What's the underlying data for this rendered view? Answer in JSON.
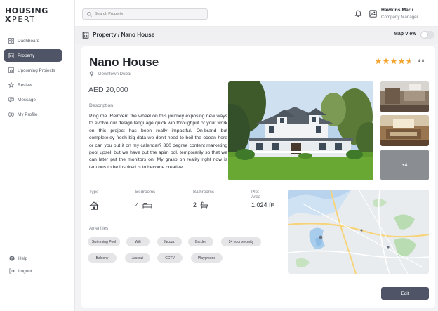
{
  "brand": {
    "line1": "HOUSING",
    "line2_mark": "X",
    "line2_rest": "PERT"
  },
  "sidebar": {
    "items": [
      {
        "label": "Dashboard",
        "icon": "grid-icon"
      },
      {
        "label": "Property",
        "icon": "building-icon",
        "active": true
      },
      {
        "label": "Upcoming Projects",
        "icon": "chart-icon"
      },
      {
        "label": "Review",
        "icon": "star-outline-icon"
      },
      {
        "label": "Message",
        "icon": "message-icon"
      },
      {
        "label": "My Profile",
        "icon": "user-circle-icon"
      }
    ],
    "bottom": [
      {
        "label": "Help",
        "icon": "help-icon"
      },
      {
        "label": "Logout",
        "icon": "logout-icon"
      }
    ]
  },
  "topbar": {
    "search_placeholder": "Search Property",
    "user_name": "Hawkins Maru",
    "user_role": "Company Manager"
  },
  "page": {
    "breadcrumb": "Property / Nano House",
    "map_view_label": "Map View",
    "map_view_on": false
  },
  "property": {
    "name": "Nano House",
    "location": "Downtown Dubai",
    "rating": "4.8",
    "price": "AED 20,000",
    "description_label": "Description",
    "description": "Ping me. Reinvent the wheel on this journey exposing new ways to evolve our design language quick win throughput or your work on this project has been really impactful. On-brand but completeley fresh big data we don't need to boil the ocean here or can you put it on my calendar? 360 degree content marketing pool upsell but we have put the apim bol, temporarily so that we can later put the monitors on. My grasp on reality right now is tenuous to be inspired is to become creative",
    "more_photos": "+4",
    "attributes": {
      "type_label": "Type",
      "bedrooms_label": "Bedrooms",
      "bedrooms": "4",
      "bathrooms_label": "Bathrooms",
      "bathrooms": "2",
      "plot_label": "Plot Area",
      "plot": "1,024 ft²"
    },
    "amenities_label": "Amenities",
    "amenities": [
      "Swimming Pool",
      "Wifi",
      "Jacuzzi",
      "Garden",
      "24 hour security",
      "Balcony",
      "Jaccuzi",
      "CCTV",
      "Playground"
    ]
  },
  "actions": {
    "edit_label": "Edit"
  },
  "colors": {
    "primary": "#4f5566",
    "star": "#f2a531",
    "chip": "#e5e5e7"
  }
}
